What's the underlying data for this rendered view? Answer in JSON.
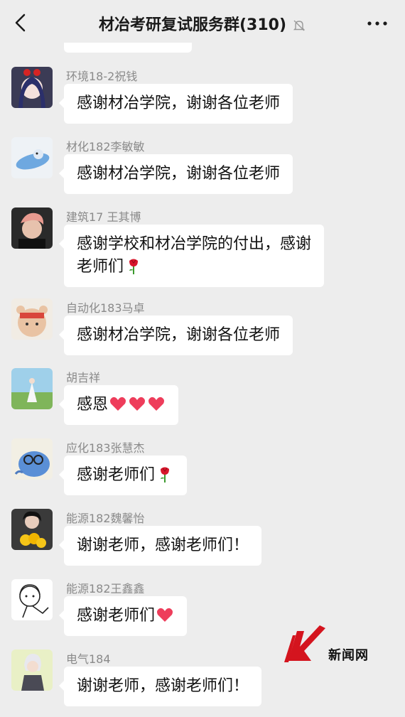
{
  "header": {
    "title": "材冶考研复试服务群(310)",
    "back_icon": "chevron-left-icon",
    "mute_icon": "bell-off-icon",
    "more_icon": "more-dots-icon"
  },
  "messages": [
    {
      "sender": "环境18-2祝钱",
      "lines": [
        "感谢材冶学院，谢谢各位老师"
      ]
    },
    {
      "sender": "材化182李敏敏",
      "lines": [
        "感谢材冶学院，谢谢各位老师"
      ]
    },
    {
      "sender": "建筑17 王其博",
      "lines": [
        "感谢学校和材冶学院的付出，感谢",
        "老师们"
      ],
      "emoji": "rose"
    },
    {
      "sender": "自动化183马卓",
      "lines": [
        "感谢材冶学院，谢谢各位老师"
      ]
    },
    {
      "sender": "胡吉祥",
      "lines": [
        "感恩"
      ],
      "emoji": "three-hearts"
    },
    {
      "sender": "应化183张慧杰",
      "lines": [
        "感谢老师们"
      ],
      "emoji": "rose"
    },
    {
      "sender": "能源182魏馨怡",
      "lines": [
        "谢谢老师，感谢老师们！"
      ]
    },
    {
      "sender": "能源182王鑫鑫",
      "lines": [
        "感谢老师们"
      ],
      "emoji": "heart"
    },
    {
      "sender": "电气184",
      "lines": [
        "谢谢老师，感谢老师们！"
      ]
    }
  ],
  "watermark": {
    "text": "新闻网",
    "color": "#d4141e"
  },
  "colors": {
    "background": "#ededed",
    "bubble": "#ffffff",
    "sender": "#8a8a8a",
    "heart": "#ee3d5b"
  }
}
